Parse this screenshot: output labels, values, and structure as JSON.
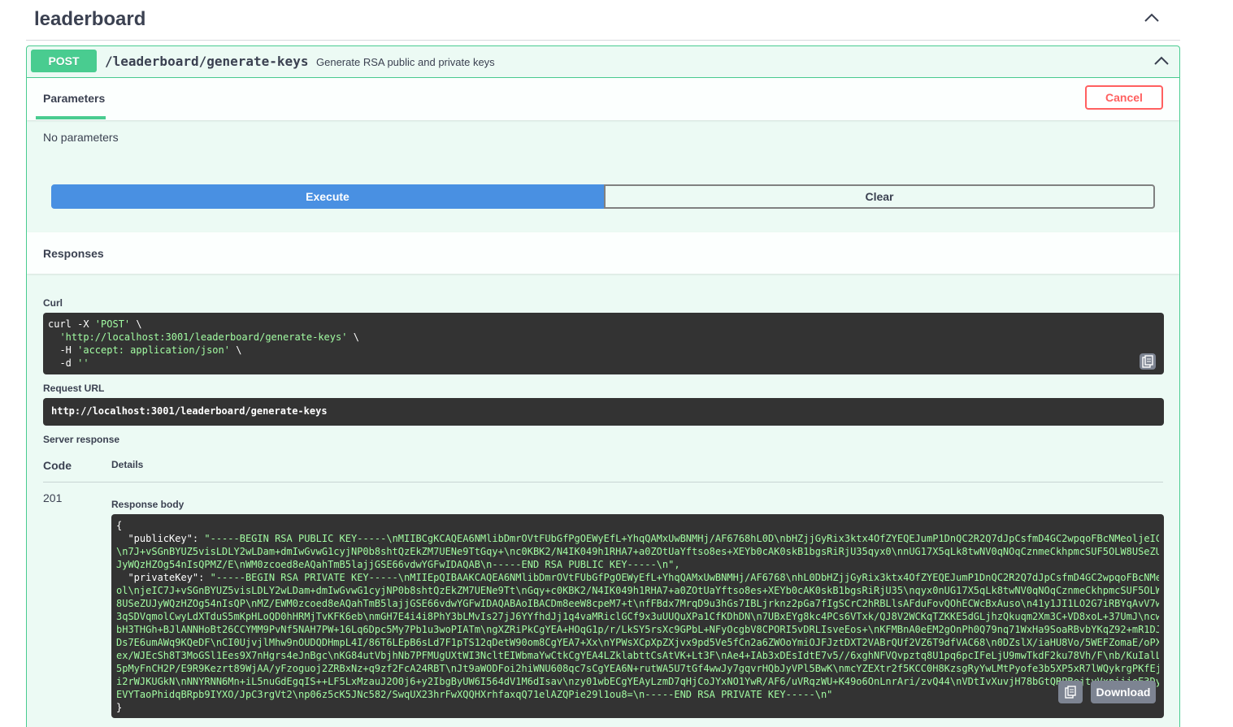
{
  "tag": {
    "title": "leaderboard"
  },
  "operation": {
    "method": "POST",
    "path": "/leaderboard/generate-keys",
    "summary": "Generate RSA public and private keys"
  },
  "parameters": {
    "tab_label": "Parameters",
    "cancel_label": "Cancel",
    "empty_text": "No parameters"
  },
  "actions": {
    "execute_label": "Execute",
    "clear_label": "Clear"
  },
  "responses": {
    "title": "Responses",
    "curl_label": "Curl",
    "curl_lines": [
      [
        "curl -X ",
        "'POST'",
        " \\"
      ],
      [
        "  ",
        "'http://localhost:3001/leaderboard/generate-keys'",
        " \\"
      ],
      [
        "  -H ",
        "'accept: application/json'",
        " \\"
      ],
      [
        "  -d ",
        "''",
        ""
      ]
    ],
    "request_url_label": "Request URL",
    "request_url": "http://localhost:3001/leaderboard/generate-keys",
    "server_response_label": "Server response",
    "code_header": "Code",
    "details_header": "Details",
    "status_code": "201",
    "response_body_label": "Response body",
    "download_label": "Download",
    "body_lines": [
      [
        "{",
        ""
      ],
      [
        "  \"publicKey\": ",
        "\"-----BEGIN RSA PUBLIC KEY-----\\nMIIBCgKCAQEA6NMlibDmrOVtFUbGfPgOEWyEfL+YhqQAMxUwBNMHj/AF6768hL0D\\nbHZjjGyRix3ktx4OfZYEQEJumP1DnQC2R2Q7dJpCsfmD4GC2wpqoFBcNMeoljeIC"
      ],
      [
        "",
        "\\n7J+vSGnBYUZ5visLDLY2wLDam+dmIwGvwG1cyjNP0b8shtQzEkZM7UENe9TtGqy+\\nc0KBK2/N4IK049h1RHA7+a0ZOtUaYftso8es+XEYb0cAK0skB1bgsRiRjU35qyx0\\nnUG17X5qLk8twNV0qNOqCznmeCkhpmcSUF5OLW8USeZU"
      ],
      [
        "",
        "JyWQzHZOg54nIsQPMZ/E\\nWM0zcoed8eAQahTmB5lajjGSE66vdwYGFwIDAQAB\\n-----END RSA PUBLIC KEY-----\\n\","
      ],
      [
        "  \"privateKey\": ",
        "\"-----BEGIN RSA PRIVATE KEY-----\\nMIIEpQIBAAKCAQEA6NMlibDmrOVtFUbGfPgOEWyEfL+YhqQAMxUwBNMHj/AF6768\\nhL0DbHZjjGyRix3ktx4OfZYEQEJumP1DnQC2R2Q7dJpCsfmD4GC2wpqoFBcNMe"
      ],
      [
        "",
        "ol\\njeIC7J+vSGnBYUZ5visLDLY2wLDam+dmIwGvwG1cyjNP0b8shtQzEkZM7UENe9Tt\\nGqy+c0KBK2/N4IK049h1RHA7+a0ZOtUaYftso8es+XEYb0cAK0skB1bgsRiRjU35\\nqyx0nUG17X5qLk8twNV0qNOqCznmeCkhpmcSUF5OLW"
      ],
      [
        "",
        "8USeZUJyWQzHZOg54nIsQP\\nMZ/EWM0zcoed8eAQahTmB5lajjGSE66vdwYGFwIDAQABAoIBACDm8eeW8cpeM7+t\\nfFBdx7MrqD9u3hGs7IBLjrknz2pGa7fIgSCrC2hRBLlsAFduFovQOhECWcBxAuso\\n41y1JI1LO2G7iRBYqAvV7w"
      ],
      [
        "",
        "3qSDVqmolCwyLdXTduS5mKpHLoQD0hHRMjTvKFK6eb\\nmGH7E4i4i8PhY3bLMvIs27jJ6YYfhdJj1q4vaMRiclGCf9x3uUUQuXPa1CfKDhDN\\n7UBxEYg8kc4PCs6VTxk/QJ8V2WCKqTZKKE5dGLjhzQkuqm2Xm3C+VD8xoL+37UmJ\\ncw"
      ],
      [
        "",
        "bH3THGh+BJlANNHoBt26CCYMM9PvNf5NAH7PW+16Lq6Dpc5My7Pb1u3woPIATm\\ngXZRiPkCgYEA+HOqG1p/r/LkSY5rsXc9GPbL+NFyOcgbV8CPORI5vDRLIsveEos+\\nKFMBnA0eEM2gOnPh0Q79nq71WxHa9SoaRBvbYKqZ92+mR1DJ"
      ],
      [
        "",
        "Ds7E6umAWq9KQeDF\\nCI0UjvjlMhw9nOUDQDHmpL4I/86T6LEpB6sLd7F1pTS12qDetW90om8CgYEA7+Xx\\nYPWsXCpXpZXjvx9pd5Ve5fCn2a6ZWOoYmiOJFJztDXT2VABrQUf2VZ6T9dfVAC68\\n0DZslX/iaHU8Vo/5WEFZomaE/oPX"
      ],
      [
        "",
        "ex/WJEcSh8T3MoGSl1Ees9X7nHgrs4eJnBgc\\nKG84utVbjhNb7PFMUgUXtWI3NcltEIWbmaYwCtkCgYEA4LZklabttCsAtVK+Lt3F\\nAe4+IAb3xDEsIdtE7v5//6xghNFVQvpztq8U1pq6pcIFeLjU9mwTkdF2ku78Vh/F\\nb/KuIalL"
      ],
      [
        "",
        "5pMyFnCH2P/E9R9Kezrt89WjAA/yFzoguoj2ZRBxNz+q9zf2FcA24RBT\\nJt9aWODFoi2hiWNU608qc7sCgYEA6N+rutWA5U7tGf4wwJy7gqvrHQbJyVPl5BwK\\nmcYZEXtr2f5KCC0H8KzsgRyYwLMtPyofe3b5XP5xR7lWQykrgPKfEj"
      ],
      [
        "",
        "i2rWJKUGkN\\nNNYRNN6Mn+iL5nuGdEgqIS++LF5LxMzauJ2O0j6+y2IbgByUW6I564dV1M6dIsav\\nzy01wbECgYEAyLzmD7qHjCoJYxNO1YwR/AF6/uVRqzWU+K49o6OnLnrAri/zvQ44\\nVDtIvXuvjH78bGtQRPBejtyVxpiiioE3Dy"
      ],
      [
        "",
        "EVYTaoPhidqBRpb9IYXO/JpC3rgVt2\\np06z5cK5JNc582/SwqUX23hrFwXQQHXrhfaxqQ71elAZQPie29l1ou8=\\n-----END RSA PRIVATE KEY-----\\n\""
      ],
      [
        "}",
        ""
      ]
    ]
  },
  "colors": {
    "post_green": "#49cc90",
    "execute_blue": "#4990e2",
    "cancel_red": "#ff6060",
    "code_bg": "#333333",
    "string_green": "#a2fca2"
  }
}
